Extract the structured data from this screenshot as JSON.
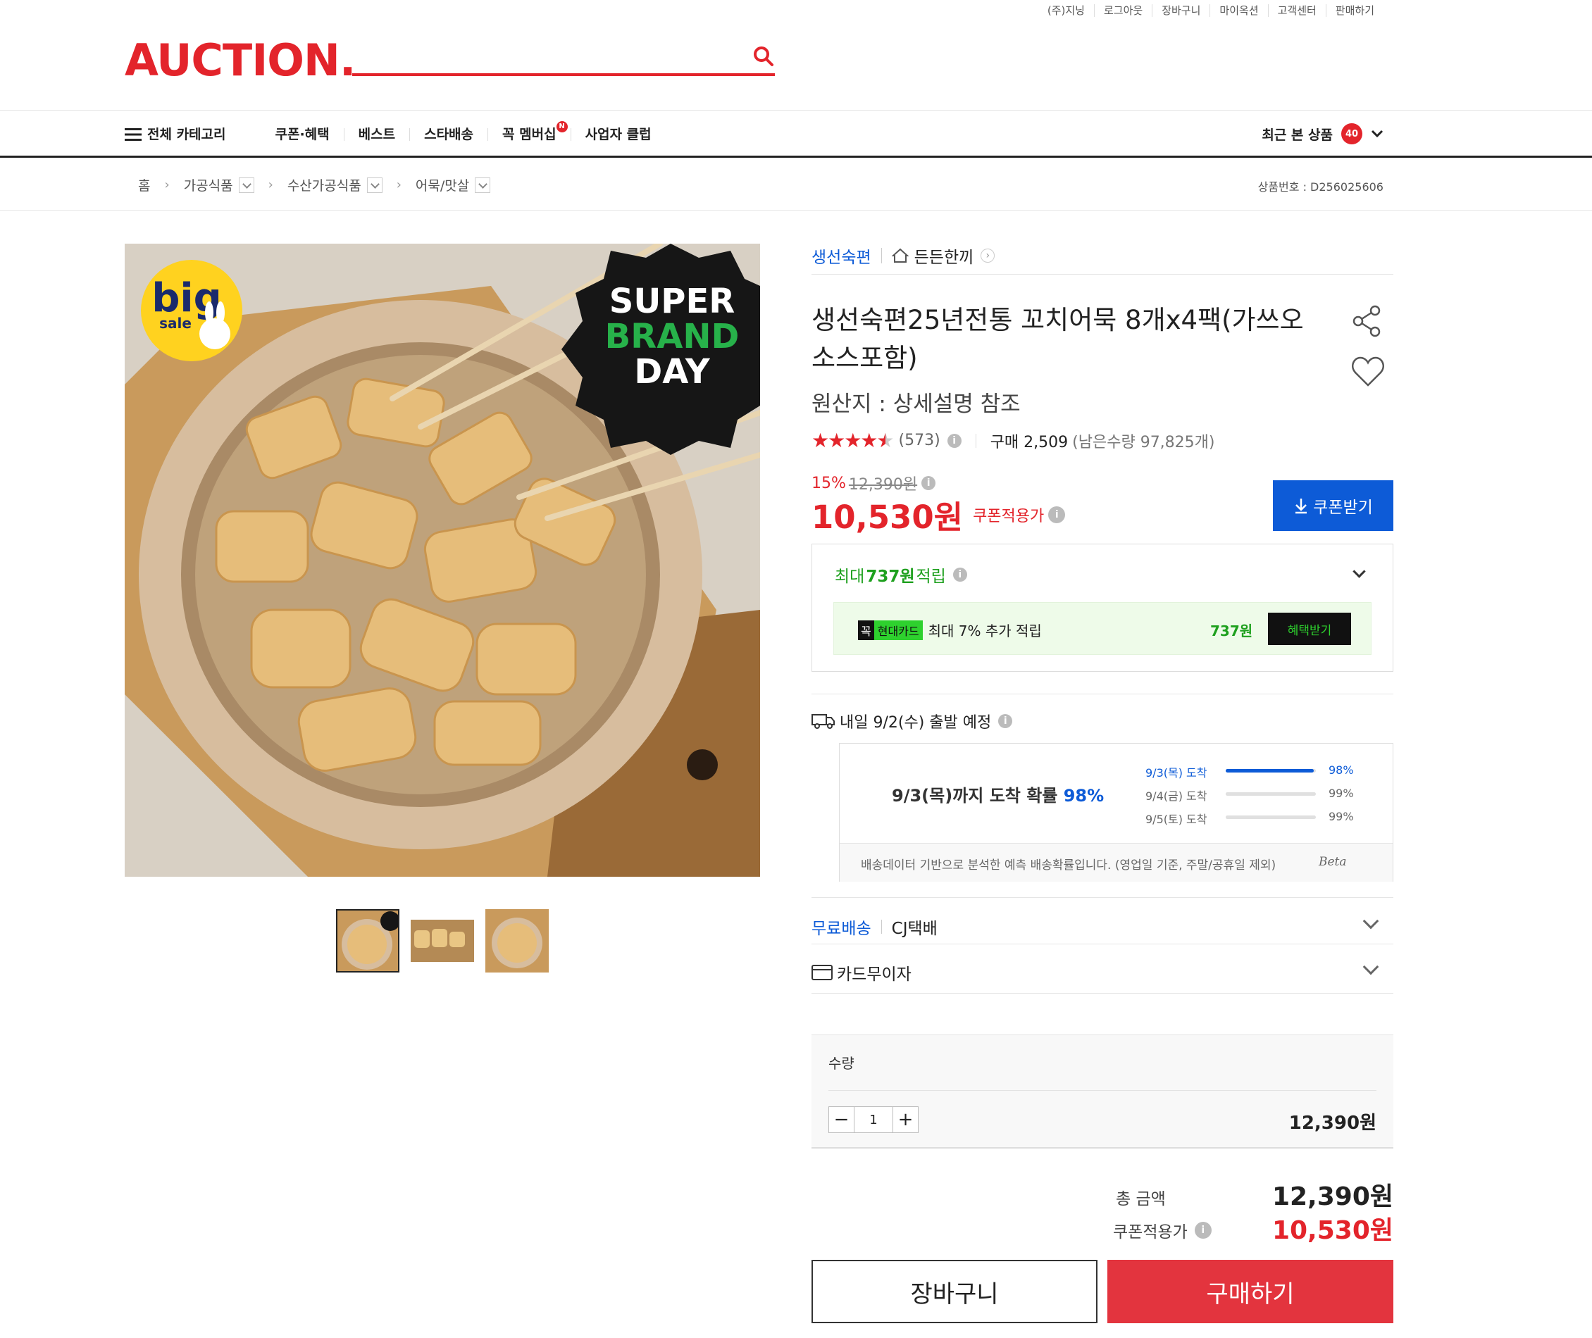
{
  "util_menu": [
    "(주)지닝",
    "로그아웃",
    "장바구니",
    "마이옥션",
    "고객센터",
    "판매하기"
  ],
  "logo": "AUCTION.",
  "gnb": {
    "all_category": "전체 카테고리",
    "items": [
      "쿠폰·혜택",
      "베스트",
      "스타배송",
      "꼭 멤버십",
      "사업자 클럽"
    ],
    "recent_label": "최근 본 상품",
    "recent_count": "40"
  },
  "breadcrumb": [
    "홈",
    "가공식품",
    "수산가공식품",
    "어묵/맛살"
  ],
  "product_no": "상품번호 : D256025606",
  "badges": {
    "big": "big",
    "sale": "sale",
    "super1": "SUPER",
    "super2": "BRAND",
    "super3": "DAY"
  },
  "brand": {
    "name": "생선숙편",
    "store": "든든한끼"
  },
  "title_line1": "생선숙편25년전통 꼬치어묵 8개x4팩(가쓰오",
  "title_line2": "소스포함)",
  "origin": "원산지 : 상세설명 참조",
  "rating": {
    "stars": 4.5,
    "count": "(573)",
    "purchase": "구매 2,509",
    "remain": "(남은수량 97,825개)"
  },
  "price": {
    "discount": "15%",
    "original": "12,390원",
    "final": "10,530원",
    "final_label": "쿠폰적용가",
    "coupon_btn": "쿠폰받기"
  },
  "reward": {
    "title_prefix": "최대 ",
    "amount": "737원",
    "title_suffix": " 적립",
    "card_tag1": "꼭",
    "card_tag2": "현대카드",
    "card_text": "최대 7% 추가 적립",
    "card_amount": "737원",
    "card_btn": "혜택받기"
  },
  "shipping": {
    "departure": "내일 9/2(수) 출발 예정",
    "prob_text": "9/3(목)까지 도착 확률",
    "prob_value": "98%",
    "rows": [
      {
        "label": "9/3(목) 도착",
        "pct": "98%",
        "value": 0.98
      },
      {
        "label": "9/4(금) 도착",
        "pct": "99%",
        "value": 0.99
      },
      {
        "label": "9/5(토) 도착",
        "pct": "99%",
        "value": 0.99
      }
    ],
    "note": "배송데이터 기반으로 분석한 예측 배송확률입니다. (영업일 기준, 주말/공휴일 제외)",
    "beta": "Beta",
    "free": "무료배송",
    "carrier": "CJ택배",
    "card": "카드무이자"
  },
  "quantity": {
    "label": "수량",
    "value": "1",
    "price": "12,390원"
  },
  "totals": {
    "total_label": "총 금액",
    "total": "12,390원",
    "coupon_label": "쿠폰적용가",
    "coupon_total": "10,530원"
  },
  "buttons": {
    "cart": "장바구니",
    "buy": "구매하기"
  },
  "colors": {
    "brand_red": "#e3242b",
    "blue": "#0d5bd7",
    "green": "#1ea01e"
  }
}
